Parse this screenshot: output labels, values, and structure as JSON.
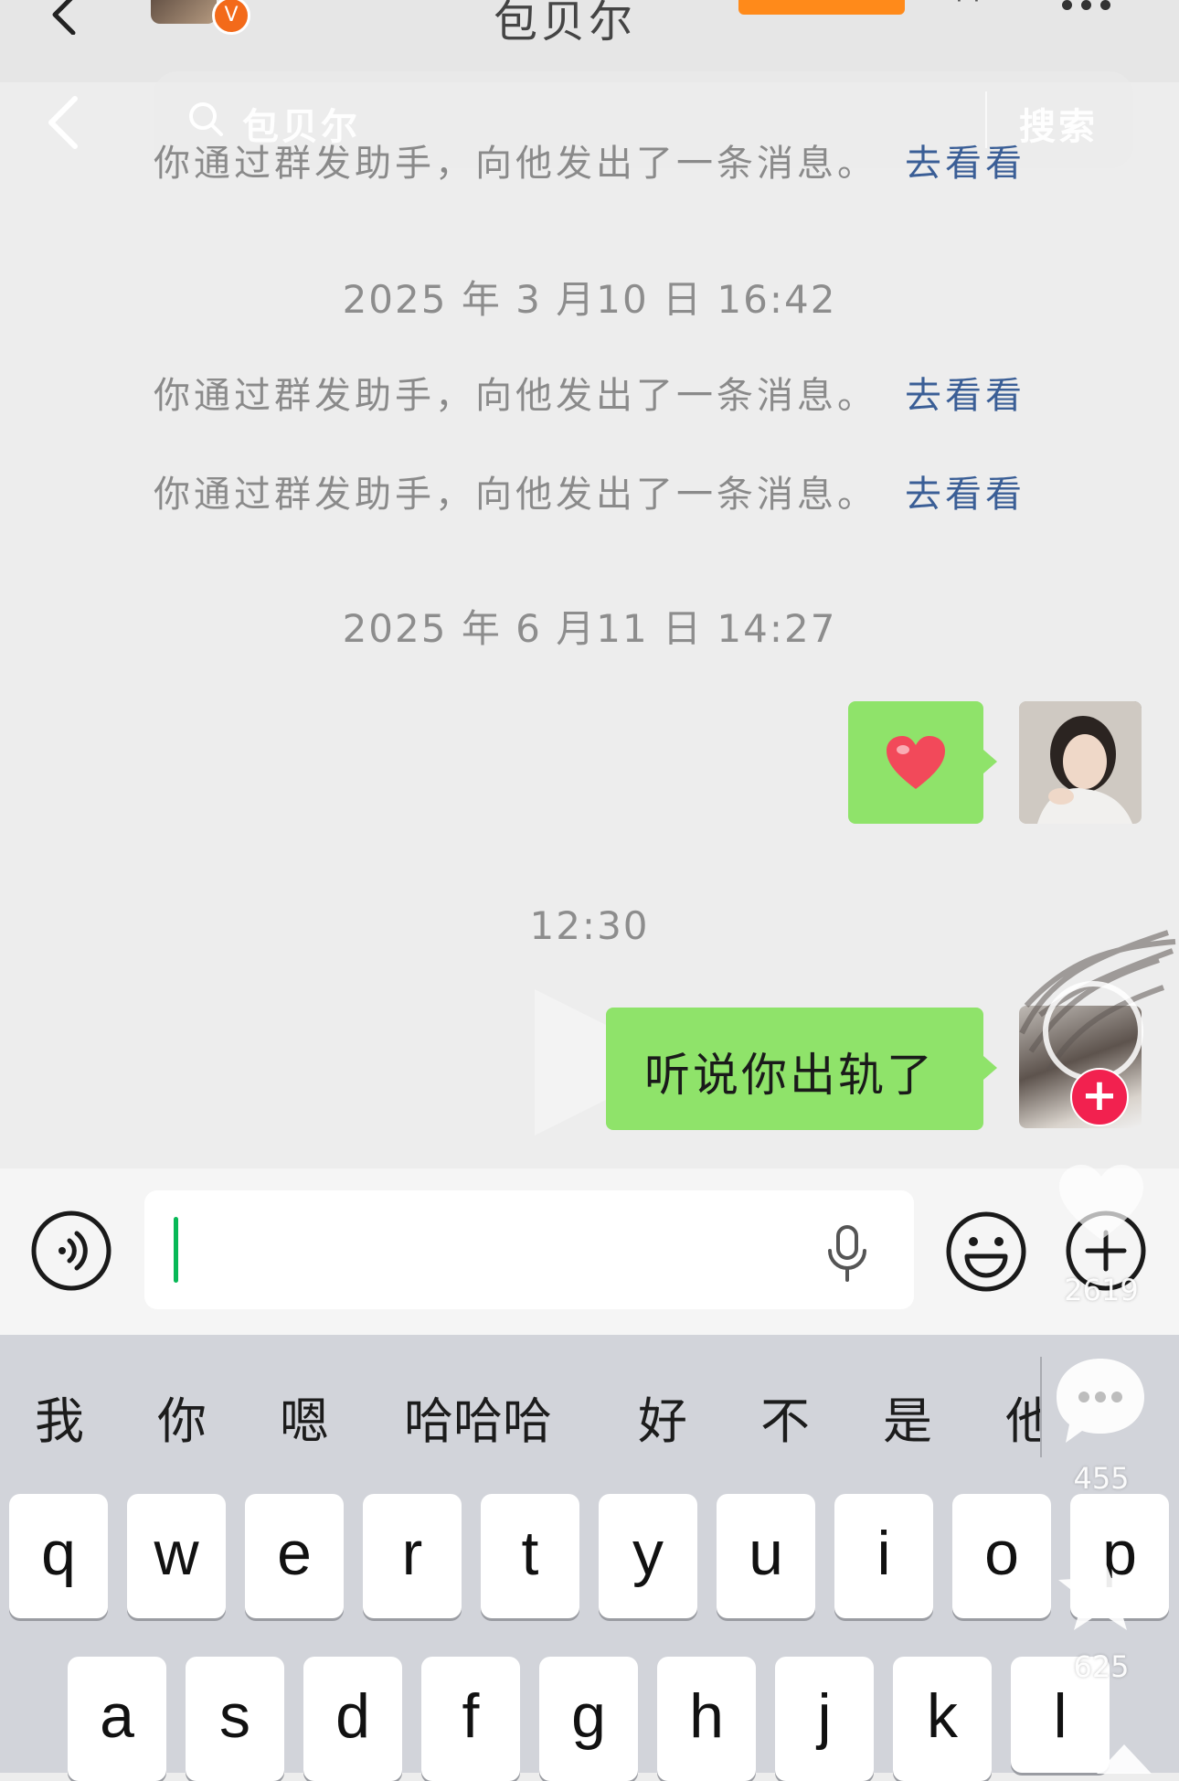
{
  "header": {
    "title": "包贝尔",
    "verified_badge": "V",
    "icons": [
      "back-chevron-icon",
      "more-dots-icon"
    ]
  },
  "search": {
    "placeholder": "包贝尔",
    "button": "搜索"
  },
  "messages": {
    "system_top": "你通过群发助手，向他发出了一条消息。",
    "timestamp_1": "2025 年 3 月10 日 16:42",
    "system_1": "你通过群发助手，向他发出了一条消息。",
    "system_2": "你通过群发助手，向他发出了一条消息。",
    "link_label": "去看看",
    "timestamp_2": "2025 年 6 月11 日 14:27",
    "heart_emoji": "❤",
    "timestamp_3": "12:30",
    "text_message": "听说你出轨了"
  },
  "keyboard": {
    "candidates": [
      "我",
      "你",
      "嗯",
      "哈哈哈",
      "好",
      "不",
      "是",
      "他"
    ],
    "row1": [
      "q",
      "w",
      "e",
      "r",
      "t",
      "y",
      "u",
      "i",
      "o",
      "p"
    ],
    "row2": [
      "a",
      "s",
      "d",
      "f",
      "g",
      "h",
      "j",
      "k",
      "l"
    ]
  },
  "video_overlay": {
    "like_count": "2619",
    "comment_count": "455",
    "favorite_count": "625"
  },
  "colors": {
    "bubble_green": "#8fe36a",
    "link_blue": "#3a5e96",
    "caret_green": "#08b857",
    "badge_orange": "#f36a1a",
    "plus_red": "#f2214f"
  }
}
